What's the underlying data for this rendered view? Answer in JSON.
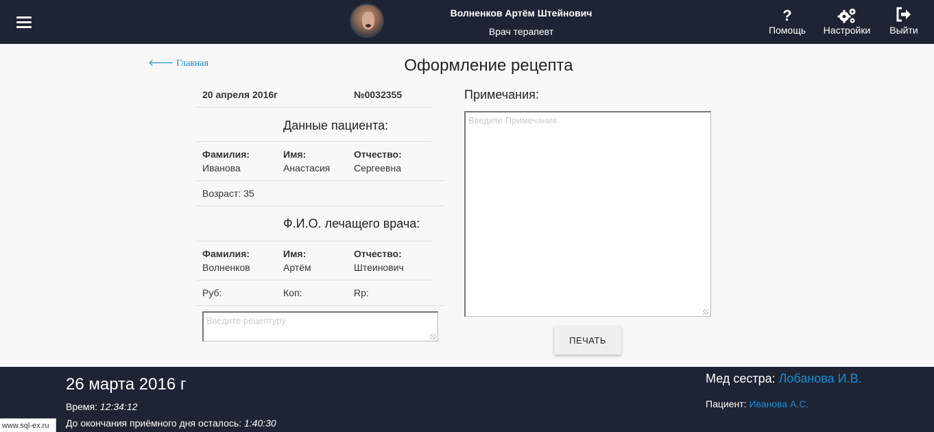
{
  "header": {
    "user_name": "Волненков Артём Штейнович",
    "user_role": "Врач терапевт",
    "help_label": "Помощь",
    "settings_label": "Настройки",
    "exit_label": "Выйти",
    "icons": [
      "menu-icon",
      "avatar",
      "question-icon",
      "gears-icon",
      "sign-out-icon"
    ]
  },
  "main": {
    "back_link": "Главная",
    "title": "Оформление рецепта",
    "date": "20 апреля 2016г",
    "number": "№0032355",
    "patient_section": "Данные пациента:",
    "patient": {
      "surname_label": "Фамилия:",
      "surname": "Иванова",
      "name_label": "Имя:",
      "name": "Анастасия",
      "patronymic_label": "Отчество:",
      "patronymic": "Сергеевна",
      "age": "Возраст: 35"
    },
    "doctor_section": "Ф.И.О. лечащего врача:",
    "doctor": {
      "surname_label": "Фамилия:",
      "surname": "Волненков",
      "name_label": "Имя:",
      "name": "Артём",
      "patronymic_label": "Отчество:",
      "patronymic": "Штеинович"
    },
    "rub_label": "Руб:",
    "kop_label": "Коп:",
    "rp_label": "Rp:",
    "recipe_placeholder": "Введите рецептуру",
    "notes_label": "Примечания:",
    "notes_placeholder": "Введите Примечания",
    "print_button": "ПЕЧАТЬ"
  },
  "footer": {
    "date": "26 марта 2016 г",
    "time_label": "Время: ",
    "time_value": "12:34:12",
    "remaining_label": "До окончания приёмного дня осталось: ",
    "remaining_value": "1:40:30",
    "nurse_label": "Мед сестра: ",
    "nurse_name": "Лобанова И.В.",
    "patient_label": "Пациент: ",
    "patient_name": "Иванова А.С.",
    "site": "www.sql-ex.ru"
  },
  "colors": {
    "bar_background": "#1e2433",
    "page_background": "#f8f8f8",
    "link": "#1a8bd1"
  }
}
